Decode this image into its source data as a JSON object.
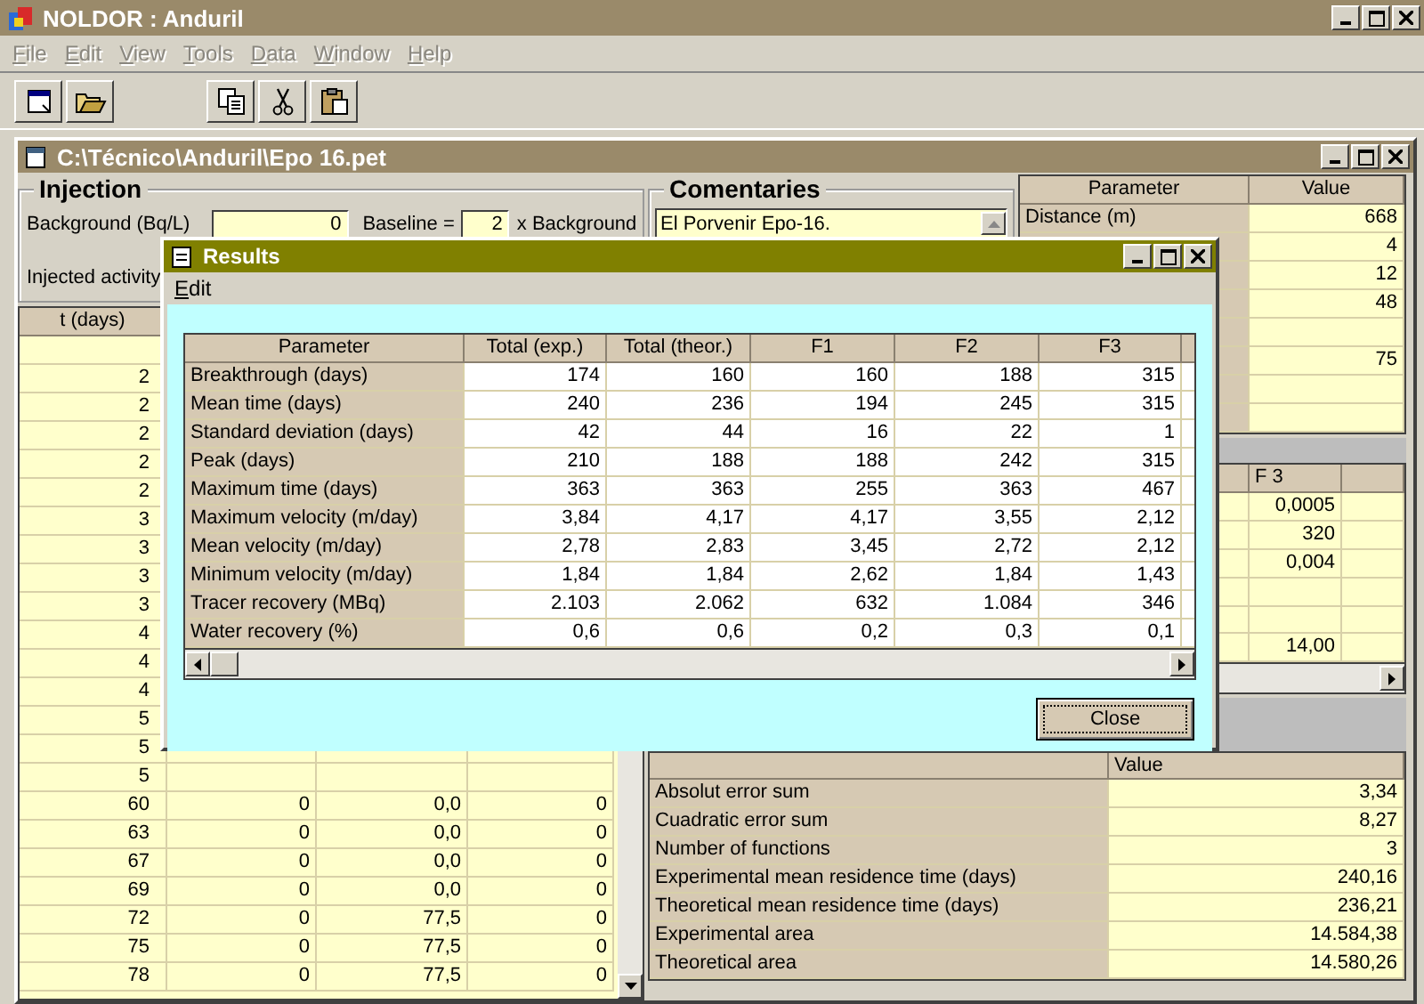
{
  "app": {
    "title": "NOLDOR : Anduril"
  },
  "menu": [
    {
      "label": "File",
      "disabled": true
    },
    {
      "label": "Edit",
      "disabled": true
    },
    {
      "label": "View",
      "disabled": true
    },
    {
      "label": "Tools",
      "disabled": true
    },
    {
      "label": "Data",
      "disabled": true
    },
    {
      "label": "Window",
      "disabled": true
    },
    {
      "label": "Help",
      "disabled": true
    }
  ],
  "document": {
    "title": "C:\\Técnico\\Anduril\\Epo 16.pet",
    "injection": {
      "title": "Injection",
      "background_label": "Background (Bq/L)",
      "background_value": "0",
      "baseline_label": "Baseline =",
      "baseline_value": "2",
      "baseline_suffix": "x Background",
      "activity_label": "Injected activity"
    },
    "comentaries": {
      "title": "Comentaries",
      "value": "El Porvenir Epo-16."
    },
    "parameters": {
      "columns": [
        "Parameter",
        "Value"
      ],
      "rows": [
        {
          "parameter": "Distance (m)",
          "value": "668"
        },
        {
          "value": "4"
        },
        {
          "value": "12"
        },
        {
          "value": "48"
        },
        {},
        {
          "value": "75"
        },
        {},
        {}
      ]
    },
    "samples": {
      "columns": [
        "t (days)"
      ],
      "rows": [
        {},
        {
          "t": "2"
        },
        {
          "t": "2"
        },
        {
          "t": "2"
        },
        {
          "t": "2"
        },
        {
          "t": "2"
        },
        {
          "t": "3"
        },
        {
          "t": "3"
        },
        {
          "t": "3"
        },
        {
          "t": "3"
        },
        {
          "t": "4"
        },
        {
          "t": "4"
        },
        {
          "t": "4"
        },
        {
          "t": "5"
        },
        {
          "t": "5"
        },
        {
          "t": "5"
        },
        {
          "t": "60",
          "column_2": "0",
          "column_3": "0,0",
          "column_4": "0"
        },
        {
          "t": "63",
          "column_2": "0",
          "column_3": "0,0",
          "column_4": "0"
        },
        {
          "t": "67",
          "column_2": "0",
          "column_3": "0,0",
          "column_4": "0"
        },
        {
          "t": "69",
          "column_2": "0",
          "column_3": "0,0",
          "column_4": "0"
        },
        {
          "t": "72",
          "column_2": "0",
          "column_3": "77,5",
          "column_4": "0"
        },
        {
          "t": "75",
          "column_2": "0",
          "column_3": "77,5",
          "column_4": "0"
        },
        {
          "t": "78",
          "column_2": "0",
          "column_3": "77,5",
          "column_4": "0"
        }
      ]
    },
    "functions": {
      "columns": [
        "F 3"
      ],
      "rows": [
        {
          "f3": "0,0005"
        },
        {
          "f3": "320"
        },
        {
          "f3": "0,004"
        },
        {},
        {},
        {
          "f3": "14,00"
        }
      ]
    },
    "summary": {
      "columns": [
        "Value"
      ],
      "rows": [
        {
          "parameter": "Absolut error sum",
          "value": "3,34"
        },
        {
          "parameter": "Cuadratic error sum",
          "value": "8,27"
        },
        {
          "parameter": "Number of functions",
          "value": "3"
        },
        {
          "parameter": "Experimental mean residence time (days)",
          "value": "240,16"
        },
        {
          "parameter": "Theoretical mean residence time (days)",
          "value": "236,21"
        },
        {
          "parameter": "Experimental area",
          "value": "14.584,38"
        },
        {
          "parameter": "Theoretical area",
          "value": "14.580,26"
        }
      ]
    }
  },
  "results": {
    "title": "Results",
    "menu": [
      "Edit"
    ],
    "columns": [
      "Parameter",
      "Total (exp.)",
      "Total (theor.)",
      "F1",
      "F2",
      "F3"
    ],
    "rows": [
      {
        "parameter": "Breakthrough (days)",
        "values": [
          "174",
          "160",
          "160",
          "188",
          "315"
        ]
      },
      {
        "parameter": "Mean time (days)",
        "values": [
          "240",
          "236",
          "194",
          "245",
          "315"
        ]
      },
      {
        "parameter": "Standard deviation (days)",
        "values": [
          "42",
          "44",
          "16",
          "22",
          "1"
        ]
      },
      {
        "parameter": "Peak (days)",
        "values": [
          "210",
          "188",
          "188",
          "242",
          "315"
        ]
      },
      {
        "parameter": "Maximum time (days)",
        "values": [
          "363",
          "363",
          "255",
          "363",
          "467"
        ]
      },
      {
        "parameter": "Maximum velocity (m/day)",
        "values": [
          "3,84",
          "4,17",
          "4,17",
          "3,55",
          "2,12"
        ]
      },
      {
        "parameter": "Mean velocity (m/day)",
        "values": [
          "2,78",
          "2,83",
          "3,45",
          "2,72",
          "2,12"
        ]
      },
      {
        "parameter": "Minimum velocity (m/day)",
        "values": [
          "1,84",
          "1,84",
          "2,62",
          "1,84",
          "1,43"
        ]
      },
      {
        "parameter": "Tracer recovery (MBq)",
        "values": [
          "2.103",
          "2.062",
          "632",
          "1.084",
          "346"
        ]
      },
      {
        "parameter": "Water recovery (%)",
        "values": [
          "0,6",
          "0,6",
          "0,2",
          "0,3",
          "0,1"
        ]
      }
    ],
    "close": "Close"
  }
}
